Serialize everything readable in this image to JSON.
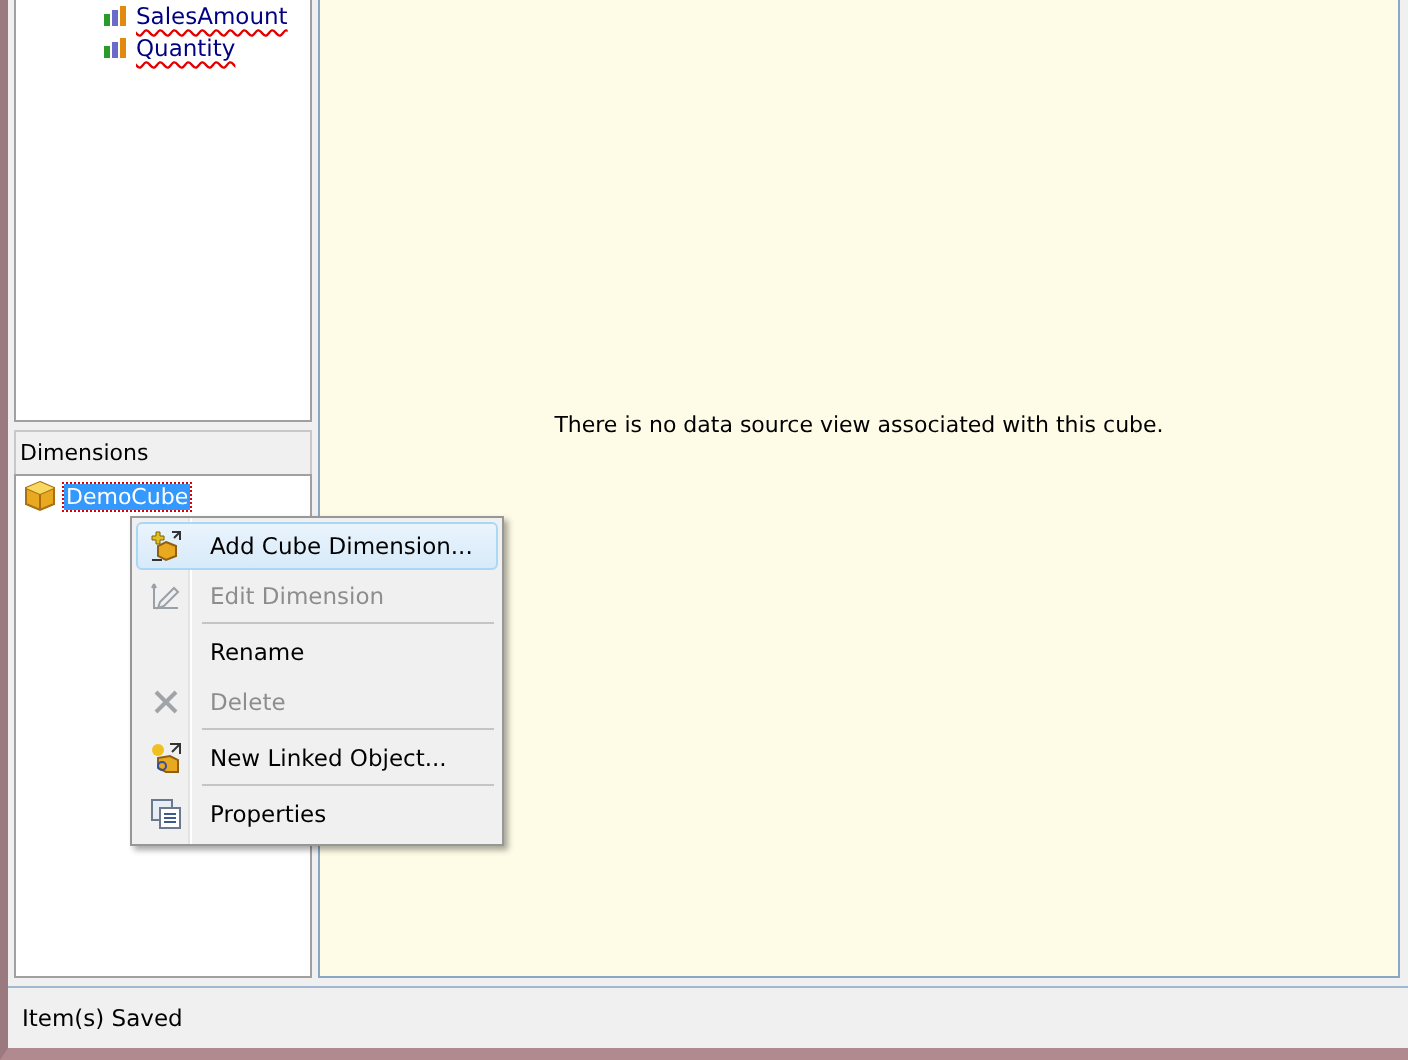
{
  "measures": [
    {
      "label": "SalesAmount"
    },
    {
      "label": "Quantity"
    }
  ],
  "dimensions_panel": {
    "title": "Dimensions",
    "items": [
      {
        "label": "DemoCube",
        "selected": true
      }
    ]
  },
  "context_menu": [
    {
      "kind": "item",
      "label": "Add Cube Dimension...",
      "disabled": false,
      "selected": true
    },
    {
      "kind": "item",
      "label": "Edit Dimension",
      "disabled": true,
      "selected": false
    },
    {
      "kind": "separator"
    },
    {
      "kind": "item",
      "label": "Rename",
      "disabled": false,
      "selected": false
    },
    {
      "kind": "item",
      "label": "Delete",
      "disabled": true,
      "selected": false
    },
    {
      "kind": "separator"
    },
    {
      "kind": "item",
      "label": "New Linked Object...",
      "disabled": false,
      "selected": false
    },
    {
      "kind": "separator"
    },
    {
      "kind": "item",
      "label": "Properties",
      "disabled": false,
      "selected": false
    }
  ],
  "main": {
    "message": "There is no data source view associated with this cube."
  },
  "status_bar": {
    "text": "Item(s) Saved"
  }
}
